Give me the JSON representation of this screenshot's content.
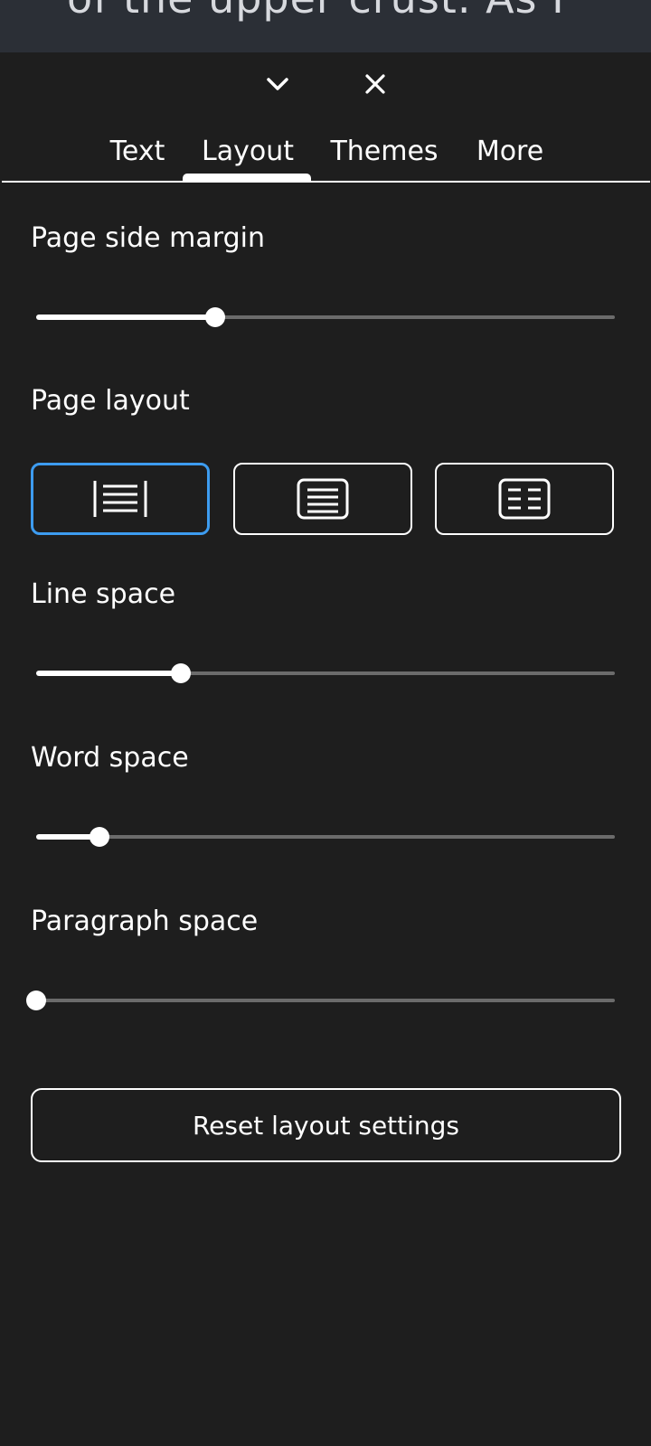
{
  "reader": {
    "background_text": "of the upper crust. As I\nlooked      at      these"
  },
  "controls": {
    "collapse_icon": "chevron-down-icon",
    "close_icon": "close-icon"
  },
  "tabs": [
    {
      "label": "Text"
    },
    {
      "label": "Layout",
      "selected": true
    },
    {
      "label": "Themes"
    },
    {
      "label": "More"
    }
  ],
  "settings": {
    "page_side_margin": {
      "label": "Page side margin",
      "value": 0.31
    },
    "page_layout": {
      "label": "Page layout",
      "options": [
        {
          "icon": "wide-margin-lines-icon",
          "selected": true
        },
        {
          "icon": "single-column-icon",
          "selected": false
        },
        {
          "icon": "two-column-icon",
          "selected": false
        }
      ]
    },
    "line_space": {
      "label": "Line space",
      "value": 0.25
    },
    "word_space": {
      "label": "Word space",
      "value": 0.11
    },
    "paragraph_space": {
      "label": "Paragraph space",
      "value": 0.0
    }
  },
  "reset_button": {
    "label": "Reset layout settings"
  },
  "colors": {
    "background": "#1e1e1e",
    "accent_selected": "#3d9cf0",
    "track": "#6b6b6b"
  }
}
